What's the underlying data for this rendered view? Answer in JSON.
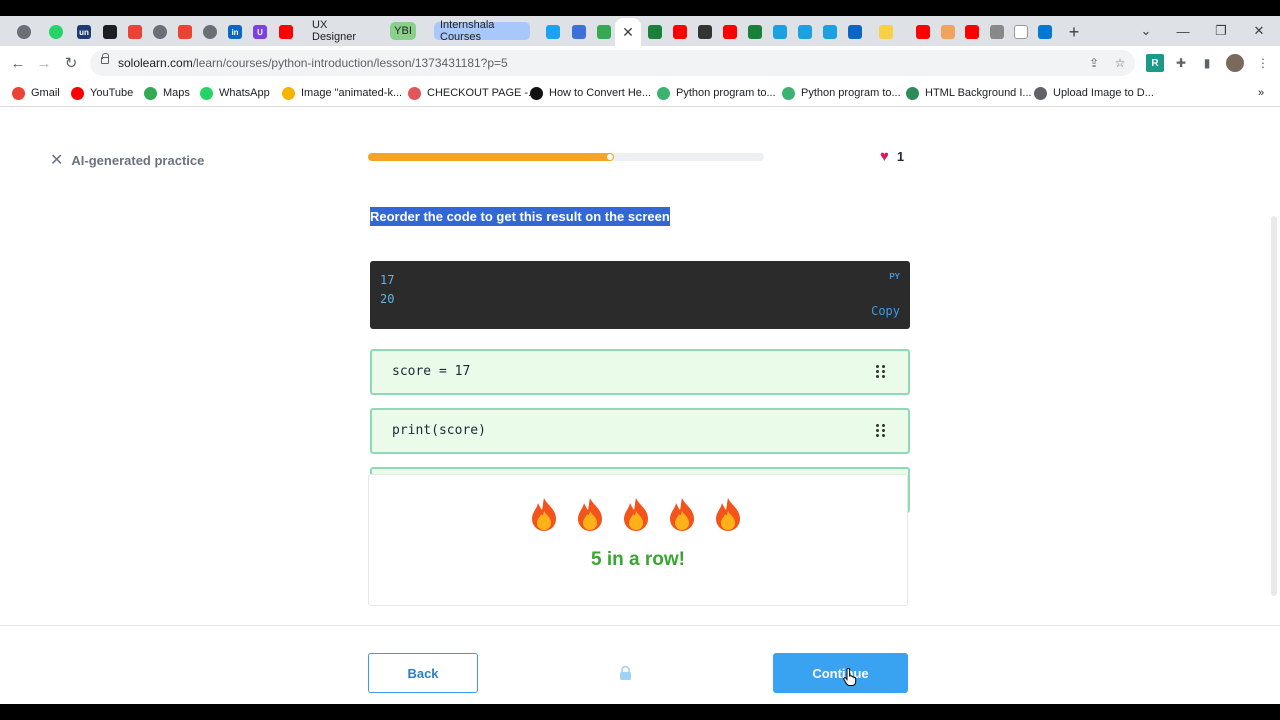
{
  "browser": {
    "tabs": [
      {
        "name": "tab-globe-1",
        "icon": "globe-icon",
        "color": "#6b6f75"
      },
      {
        "name": "tab-whatsapp",
        "icon": "whatsapp-icon",
        "color": "#25d366"
      },
      {
        "name": "tab-unstop",
        "icon": "unstop-icon",
        "label": "un",
        "color": "#1f3a6e"
      },
      {
        "name": "tab-github",
        "icon": "github-icon",
        "color": "#1b1f23"
      },
      {
        "name": "tab-gmail-1",
        "icon": "gmail-icon",
        "color": "#ea4335"
      },
      {
        "name": "tab-globe-2",
        "icon": "globe-icon",
        "color": "#6b6f75"
      },
      {
        "name": "tab-gmail-2",
        "icon": "gmail-icon",
        "color": "#ea4335"
      },
      {
        "name": "tab-globe-3",
        "icon": "globe-icon",
        "color": "#6b6f75"
      },
      {
        "name": "tab-linkedin",
        "icon": "linkedin-icon",
        "label": "in",
        "color": "#0a66c2"
      },
      {
        "name": "tab-u",
        "icon": "u-icon",
        "label": "U",
        "color": "#7b3fe4"
      },
      {
        "name": "tab-youtube-1",
        "icon": "youtube-icon",
        "color": "#ff0000"
      }
    ],
    "named_tabs": [
      {
        "name": "tab-ux-designer",
        "label": "UX Designer",
        "bg": "#e8eaed"
      },
      {
        "name": "tab-ybi",
        "label": "YBI",
        "bg": "#8ad08a"
      },
      {
        "name": "tab-internshala",
        "label": "Internshala Courses",
        "bg": "#a8c7fa"
      }
    ],
    "url_host": "sololearn.com",
    "url_path": "/learn/courses/python-introduction/lesson/1373431181?p=5",
    "bookmarks": [
      {
        "name": "bookmark-gmail",
        "label": "Gmail",
        "color": "#ea4335"
      },
      {
        "name": "bookmark-youtube",
        "label": "YouTube",
        "color": "#ff0000"
      },
      {
        "name": "bookmark-maps",
        "label": "Maps",
        "color": "#34a853"
      },
      {
        "name": "bookmark-whatsapp",
        "label": "WhatsApp",
        "color": "#25d366"
      },
      {
        "name": "bookmark-image",
        "label": "Image \"animated-k...",
        "color": "#f4b400"
      },
      {
        "name": "bookmark-checkout",
        "label": "CHECKOUT PAGE -...",
        "color": "#e0565b"
      },
      {
        "name": "bookmark-how-to-convert",
        "label": "How to Convert He...",
        "color": "#111111"
      },
      {
        "name": "bookmark-python-1",
        "label": "Python program to...",
        "color": "#3cb371"
      },
      {
        "name": "bookmark-python-2",
        "label": "Python program to...",
        "color": "#3cb371"
      },
      {
        "name": "bookmark-html-bg",
        "label": "HTML Background I...",
        "color": "#2e8b57"
      },
      {
        "name": "bookmark-upload-image",
        "label": "Upload Image to D...",
        "color": "#5f6368"
      }
    ],
    "more_bookmarks": "»"
  },
  "lesson": {
    "close_label": "AI-generated practice",
    "progress": 0.62,
    "hearts": "1",
    "instruction": "Reorder the code to get this result on the screen",
    "output_lines": [
      "17",
      "20"
    ],
    "output_lang": "PY",
    "copy_label": "Copy",
    "code_blocks": [
      "score = 17",
      "print(score)"
    ],
    "streak_count": 5,
    "streak_text": "5 in a row!",
    "back_label": "Back",
    "continue_label": "Continue"
  },
  "colors": {
    "accent": "#3aa3f1",
    "progress": "#f2a623",
    "streak": "#3aa631",
    "heart": "#d81b60"
  }
}
